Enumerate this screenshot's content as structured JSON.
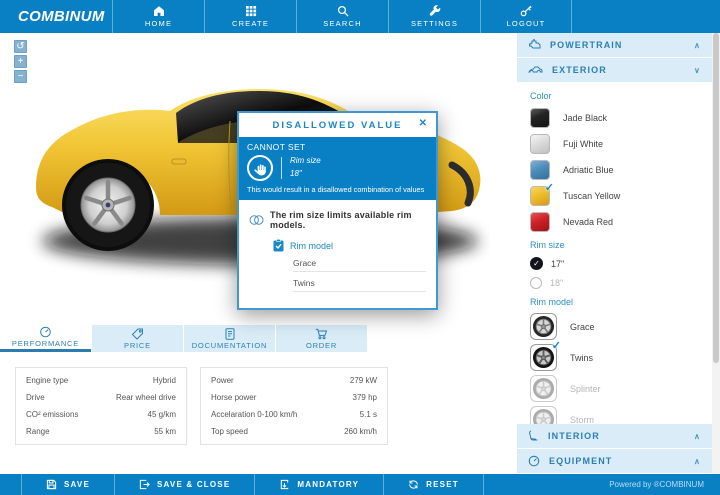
{
  "app": {
    "logo": "COMBINUM",
    "powered_by": "Powered by ®COMBINUM",
    "colors": {
      "brand_blue": "#0a80c4",
      "light_blue": "#d9ecf8",
      "accent_blue": "#1b87c6"
    }
  },
  "nav": {
    "items": [
      {
        "label": "HOME",
        "icon": "home-icon"
      },
      {
        "label": "CREATE",
        "icon": "create-icon"
      },
      {
        "label": "SEARCH",
        "icon": "search-icon"
      },
      {
        "label": "SETTINGS",
        "icon": "settings-icon"
      },
      {
        "label": "LOGOUT",
        "icon": "logout-icon"
      }
    ]
  },
  "canvas": {
    "controls": {
      "reset": "↺",
      "zoom_in": "+",
      "zoom_out": "−"
    }
  },
  "dialog": {
    "title": "DISALLOWED VALUE",
    "close": "✕",
    "cannot_set": "CANNOT SET",
    "field": "Rim size",
    "value": "18\"",
    "note": "This would result in a disallowed combination of values",
    "message": "The rim size limits available rim models.",
    "related_label": "Rim model",
    "related": [
      "Grace",
      "Twins"
    ]
  },
  "sidebar": {
    "sections": {
      "powertrain": {
        "label": "POWERTRAIN",
        "chevron": "∧"
      },
      "exterior": {
        "label": "EXTERIOR",
        "chevron": "∨"
      },
      "interior": {
        "label": "INTERIOR",
        "chevron": "∧"
      },
      "equipment": {
        "label": "EQUIPMENT",
        "chevron": "∧"
      }
    },
    "color": {
      "label": "Color",
      "options": [
        {
          "name": "Jade Black",
          "hex": "#242424",
          "selected": false
        },
        {
          "name": "Fuji White",
          "hex": "#dcdcdc",
          "selected": false
        },
        {
          "name": "Adriatic Blue",
          "hex": "#4d8cba",
          "selected": false
        },
        {
          "name": "Tuscan Yellow",
          "hex": "#eebd2f",
          "selected": true
        },
        {
          "name": "Nevada Red",
          "hex": "#cd2127",
          "selected": false
        }
      ],
      "check": "✓"
    },
    "rim_size": {
      "label": "Rim size",
      "options": [
        {
          "name": "17\"",
          "selected": true,
          "disabled": false
        },
        {
          "name": "18\"",
          "selected": false,
          "disabled": true
        }
      ],
      "check": "✓"
    },
    "rim_model": {
      "label": "Rim model",
      "options": [
        {
          "name": "Grace",
          "selected": false,
          "disabled": false
        },
        {
          "name": "Twins",
          "selected": true,
          "disabled": false
        },
        {
          "name": "Splinter",
          "selected": false,
          "disabled": true
        },
        {
          "name": "Storm",
          "selected": false,
          "disabled": true
        }
      ],
      "check": "✓"
    }
  },
  "tabs": {
    "items": [
      {
        "label": "PERFORMANCE",
        "active": true
      },
      {
        "label": "PRICE",
        "active": false
      },
      {
        "label": "DOCUMENTATION",
        "active": false
      },
      {
        "label": "ORDER",
        "active": false
      }
    ]
  },
  "performance": {
    "left": [
      {
        "label": "Engine type",
        "value": "Hybrid"
      },
      {
        "label": "Drive",
        "value": "Rear wheel drive"
      },
      {
        "label": "CO² emissions",
        "value": "45  g/km"
      },
      {
        "label": "Range",
        "value": "55  km"
      }
    ],
    "right": [
      {
        "label": "Power",
        "value": "279  kW"
      },
      {
        "label": "Horse power",
        "value": "379  hp"
      },
      {
        "label": "Accelaration 0-100 km/h",
        "value": "5.1  s"
      },
      {
        "label": "Top speed",
        "value": "260  km/h"
      }
    ]
  },
  "footer": {
    "buttons": [
      {
        "label": "SAVE",
        "icon": "save-icon"
      },
      {
        "label": "SAVE & CLOSE",
        "icon": "save-close-icon"
      },
      {
        "label": "MANDATORY",
        "icon": "mandatory-icon"
      },
      {
        "label": "RESET",
        "icon": "reset-icon"
      }
    ]
  }
}
